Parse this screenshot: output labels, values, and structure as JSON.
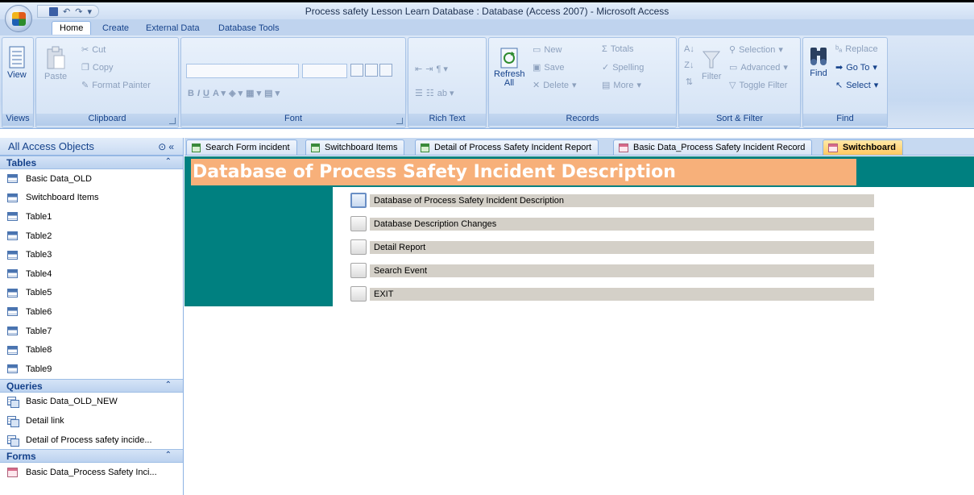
{
  "window": {
    "title": "Process safety Lesson Learn Database : Database (Access 2007) - Microsoft Access"
  },
  "ribbon_tabs": [
    "Home",
    "Create",
    "External Data",
    "Database Tools"
  ],
  "groups": {
    "views": {
      "label": "Views",
      "view": "View"
    },
    "clipboard": {
      "label": "Clipboard",
      "paste": "Paste",
      "cut": "Cut",
      "copy": "Copy",
      "format_painter": "Format Painter"
    },
    "font": {
      "label": "Font"
    },
    "rich_text": {
      "label": "Rich Text"
    },
    "records": {
      "label": "Records",
      "refresh": "Refresh All",
      "new": "New",
      "save": "Save",
      "delete": "Delete",
      "totals": "Totals",
      "spelling": "Spelling",
      "more": "More"
    },
    "sort_filter": {
      "label": "Sort & Filter",
      "filter": "Filter",
      "selection": "Selection",
      "advanced": "Advanced",
      "toggle_filter": "Toggle Filter"
    },
    "find": {
      "label": "Find",
      "find": "Find",
      "replace": "Replace",
      "goto": "Go To",
      "select": "Select"
    }
  },
  "nav": {
    "title": "All Access Objects",
    "sections": [
      {
        "label": "Tables",
        "type": "table",
        "items": [
          "Basic Data_OLD",
          "Switchboard Items",
          "Table1",
          "Table2",
          "Table3",
          "Table4",
          "Table5",
          "Table6",
          "Table7",
          "Table8",
          "Table9"
        ]
      },
      {
        "label": "Queries",
        "type": "query",
        "items": [
          "Basic Data_OLD_NEW",
          "Detail link",
          "Detail of Process safety incide..."
        ]
      },
      {
        "label": "Forms",
        "type": "form",
        "items": [
          "Basic Data_Process Safety Inci..."
        ]
      }
    ]
  },
  "doc_tabs": [
    "Search Form incident",
    "Switchboard Items",
    "Detail of Process Safety Incident Report",
    "Basic Data_Process Safety Incident Record",
    "Switchboard"
  ],
  "switchboard": {
    "heading": "Database of Process Safety Incident Description",
    "items": [
      "Database of Process Safety Incident Description",
      "Database Description Changes",
      "Detail Report",
      "Search Event",
      "EXIT"
    ]
  }
}
